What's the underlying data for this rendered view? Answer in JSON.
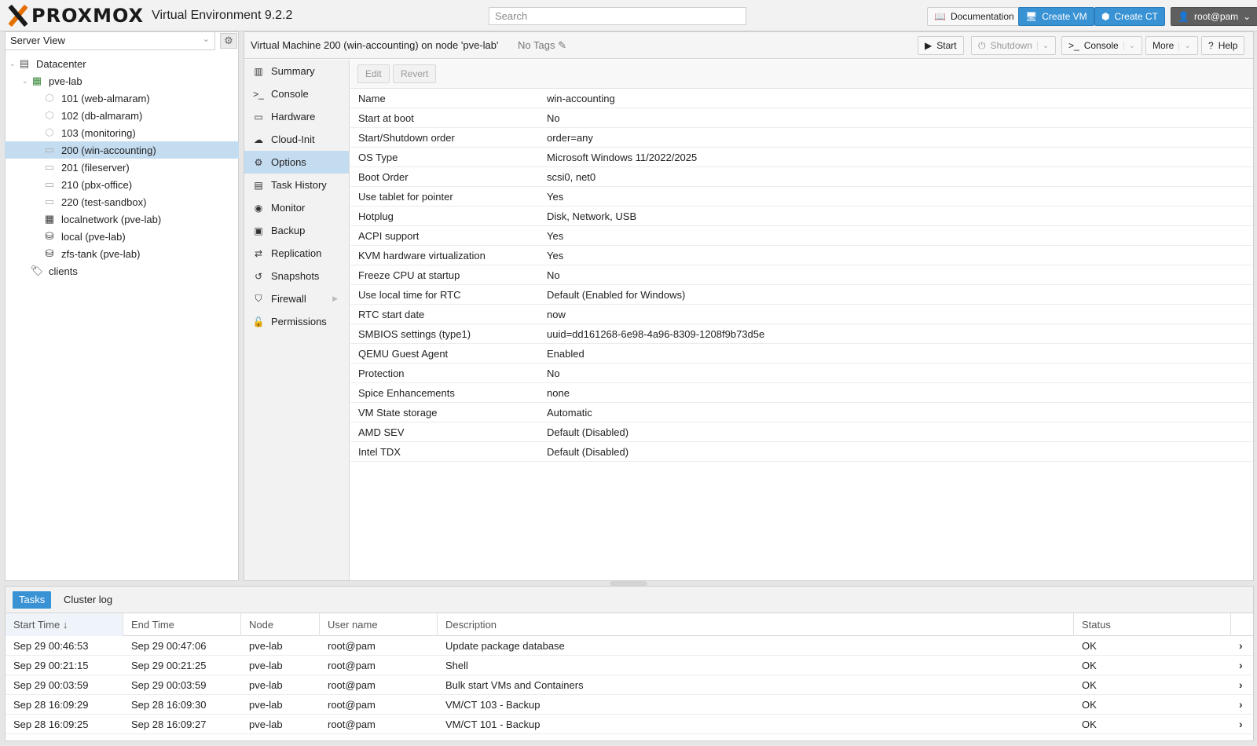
{
  "header": {
    "brand": "PROXMOX",
    "product": "Virtual Environment 9.2.2",
    "search_placeholder": "Search",
    "documentation_label": "Documentation",
    "create_vm_label": "Create VM",
    "create_ct_label": "Create CT",
    "user_label": "root@pam"
  },
  "sidebar": {
    "view": "Server View",
    "tree": [
      {
        "label": "Datacenter",
        "icon": "datacenter-icon"
      },
      {
        "label": "pve-lab",
        "icon": "node-online-icon"
      },
      {
        "label": "101 (web-almaram)",
        "icon": "container-icon"
      },
      {
        "label": "102 (db-almaram)",
        "icon": "container-icon"
      },
      {
        "label": "103 (monitoring)",
        "icon": "container-icon"
      },
      {
        "label": "200 (win-accounting)",
        "icon": "vm-monitor-icon"
      },
      {
        "label": "201 (fileserver)",
        "icon": "vm-monitor-icon"
      },
      {
        "label": "210 (pbx-office)",
        "icon": "vm-monitor-icon"
      },
      {
        "label": "220 (test-sandbox)",
        "icon": "vm-monitor-icon"
      },
      {
        "label": "localnetwork (pve-lab)",
        "icon": "network-grid-icon"
      },
      {
        "label": "local (pve-lab)",
        "icon": "storage-icon"
      },
      {
        "label": "zfs-tank (pve-lab)",
        "icon": "storage-icon"
      },
      {
        "label": "clients",
        "icon": "tags-icon"
      }
    ]
  },
  "vm_header": {
    "title": "Virtual Machine 200 (win-accounting) on node 'pve-lab'",
    "tags": "No Tags",
    "start_label": "Start",
    "shutdown_label": "Shutdown",
    "console_label": "Console",
    "more_label": "More",
    "help_label": "Help"
  },
  "subnav": [
    {
      "label": "Summary",
      "icon": "book-icon"
    },
    {
      "label": "Console",
      "icon": "terminal-icon"
    },
    {
      "label": "Hardware",
      "icon": "monitor-icon"
    },
    {
      "label": "Cloud-Init",
      "icon": "cloud-icon"
    },
    {
      "label": "Options",
      "icon": "gear-icon"
    },
    {
      "label": "Task History",
      "icon": "list-icon"
    },
    {
      "label": "Monitor",
      "icon": "eye-icon"
    },
    {
      "label": "Backup",
      "icon": "floppy-icon"
    },
    {
      "label": "Replication",
      "icon": "retweet-icon"
    },
    {
      "label": "Snapshots",
      "icon": "history-icon"
    },
    {
      "label": "Firewall",
      "icon": "shield-icon"
    },
    {
      "label": "Permissions",
      "icon": "unlock-icon"
    }
  ],
  "options": {
    "edit_label": "Edit",
    "revert_label": "Revert",
    "rows": [
      {
        "key": "Name",
        "value": "win-accounting"
      },
      {
        "key": "Start at boot",
        "value": "No"
      },
      {
        "key": "Start/Shutdown order",
        "value": "order=any"
      },
      {
        "key": "OS Type",
        "value": "Microsoft Windows 11/2022/2025"
      },
      {
        "key": "Boot Order",
        "value": "scsi0, net0"
      },
      {
        "key": "Use tablet for pointer",
        "value": "Yes"
      },
      {
        "key": "Hotplug",
        "value": "Disk, Network, USB"
      },
      {
        "key": "ACPI support",
        "value": "Yes"
      },
      {
        "key": "KVM hardware virtualization",
        "value": "Yes"
      },
      {
        "key": "Freeze CPU at startup",
        "value": "No"
      },
      {
        "key": "Use local time for RTC",
        "value": "Default (Enabled for Windows)"
      },
      {
        "key": "RTC start date",
        "value": "now"
      },
      {
        "key": "SMBIOS settings (type1)",
        "value": "uuid=dd161268-6e98-4a96-8309-1208f9b73d5e"
      },
      {
        "key": "QEMU Guest Agent",
        "value": "Enabled"
      },
      {
        "key": "Protection",
        "value": "No"
      },
      {
        "key": "Spice Enhancements",
        "value": "none"
      },
      {
        "key": "VM State storage",
        "value": "Automatic"
      },
      {
        "key": "AMD SEV",
        "value": "Default (Disabled)"
      },
      {
        "key": "Intel TDX",
        "value": "Default (Disabled)"
      }
    ]
  },
  "tasks": {
    "tab_tasks": "Tasks",
    "tab_cluster_log": "Cluster log",
    "columns": [
      "Start Time",
      "End Time",
      "Node",
      "User name",
      "Description",
      "Status"
    ],
    "rows": [
      {
        "start": "Sep 29 00:46:53",
        "end": "Sep 29 00:47:06",
        "node": "pve-lab",
        "user": "root@pam",
        "desc": "Update package database",
        "status": "OK"
      },
      {
        "start": "Sep 29 00:21:15",
        "end": "Sep 29 00:21:25",
        "node": "pve-lab",
        "user": "root@pam",
        "desc": "Shell",
        "status": "OK"
      },
      {
        "start": "Sep 29 00:03:59",
        "end": "Sep 29 00:03:59",
        "node": "pve-lab",
        "user": "root@pam",
        "desc": "Bulk start VMs and Containers",
        "status": "OK"
      },
      {
        "start": "Sep 28 16:09:29",
        "end": "Sep 28 16:09:30",
        "node": "pve-lab",
        "user": "root@pam",
        "desc": "VM/CT 103 - Backup",
        "status": "OK"
      },
      {
        "start": "Sep 28 16:09:25",
        "end": "Sep 28 16:09:27",
        "node": "pve-lab",
        "user": "root@pam",
        "desc": "VM/CT 101 - Backup",
        "status": "OK"
      }
    ]
  },
  "colors": {
    "accent": "#3892d4",
    "selection": "#c4dcf0",
    "brand_orange": "#e57000"
  }
}
